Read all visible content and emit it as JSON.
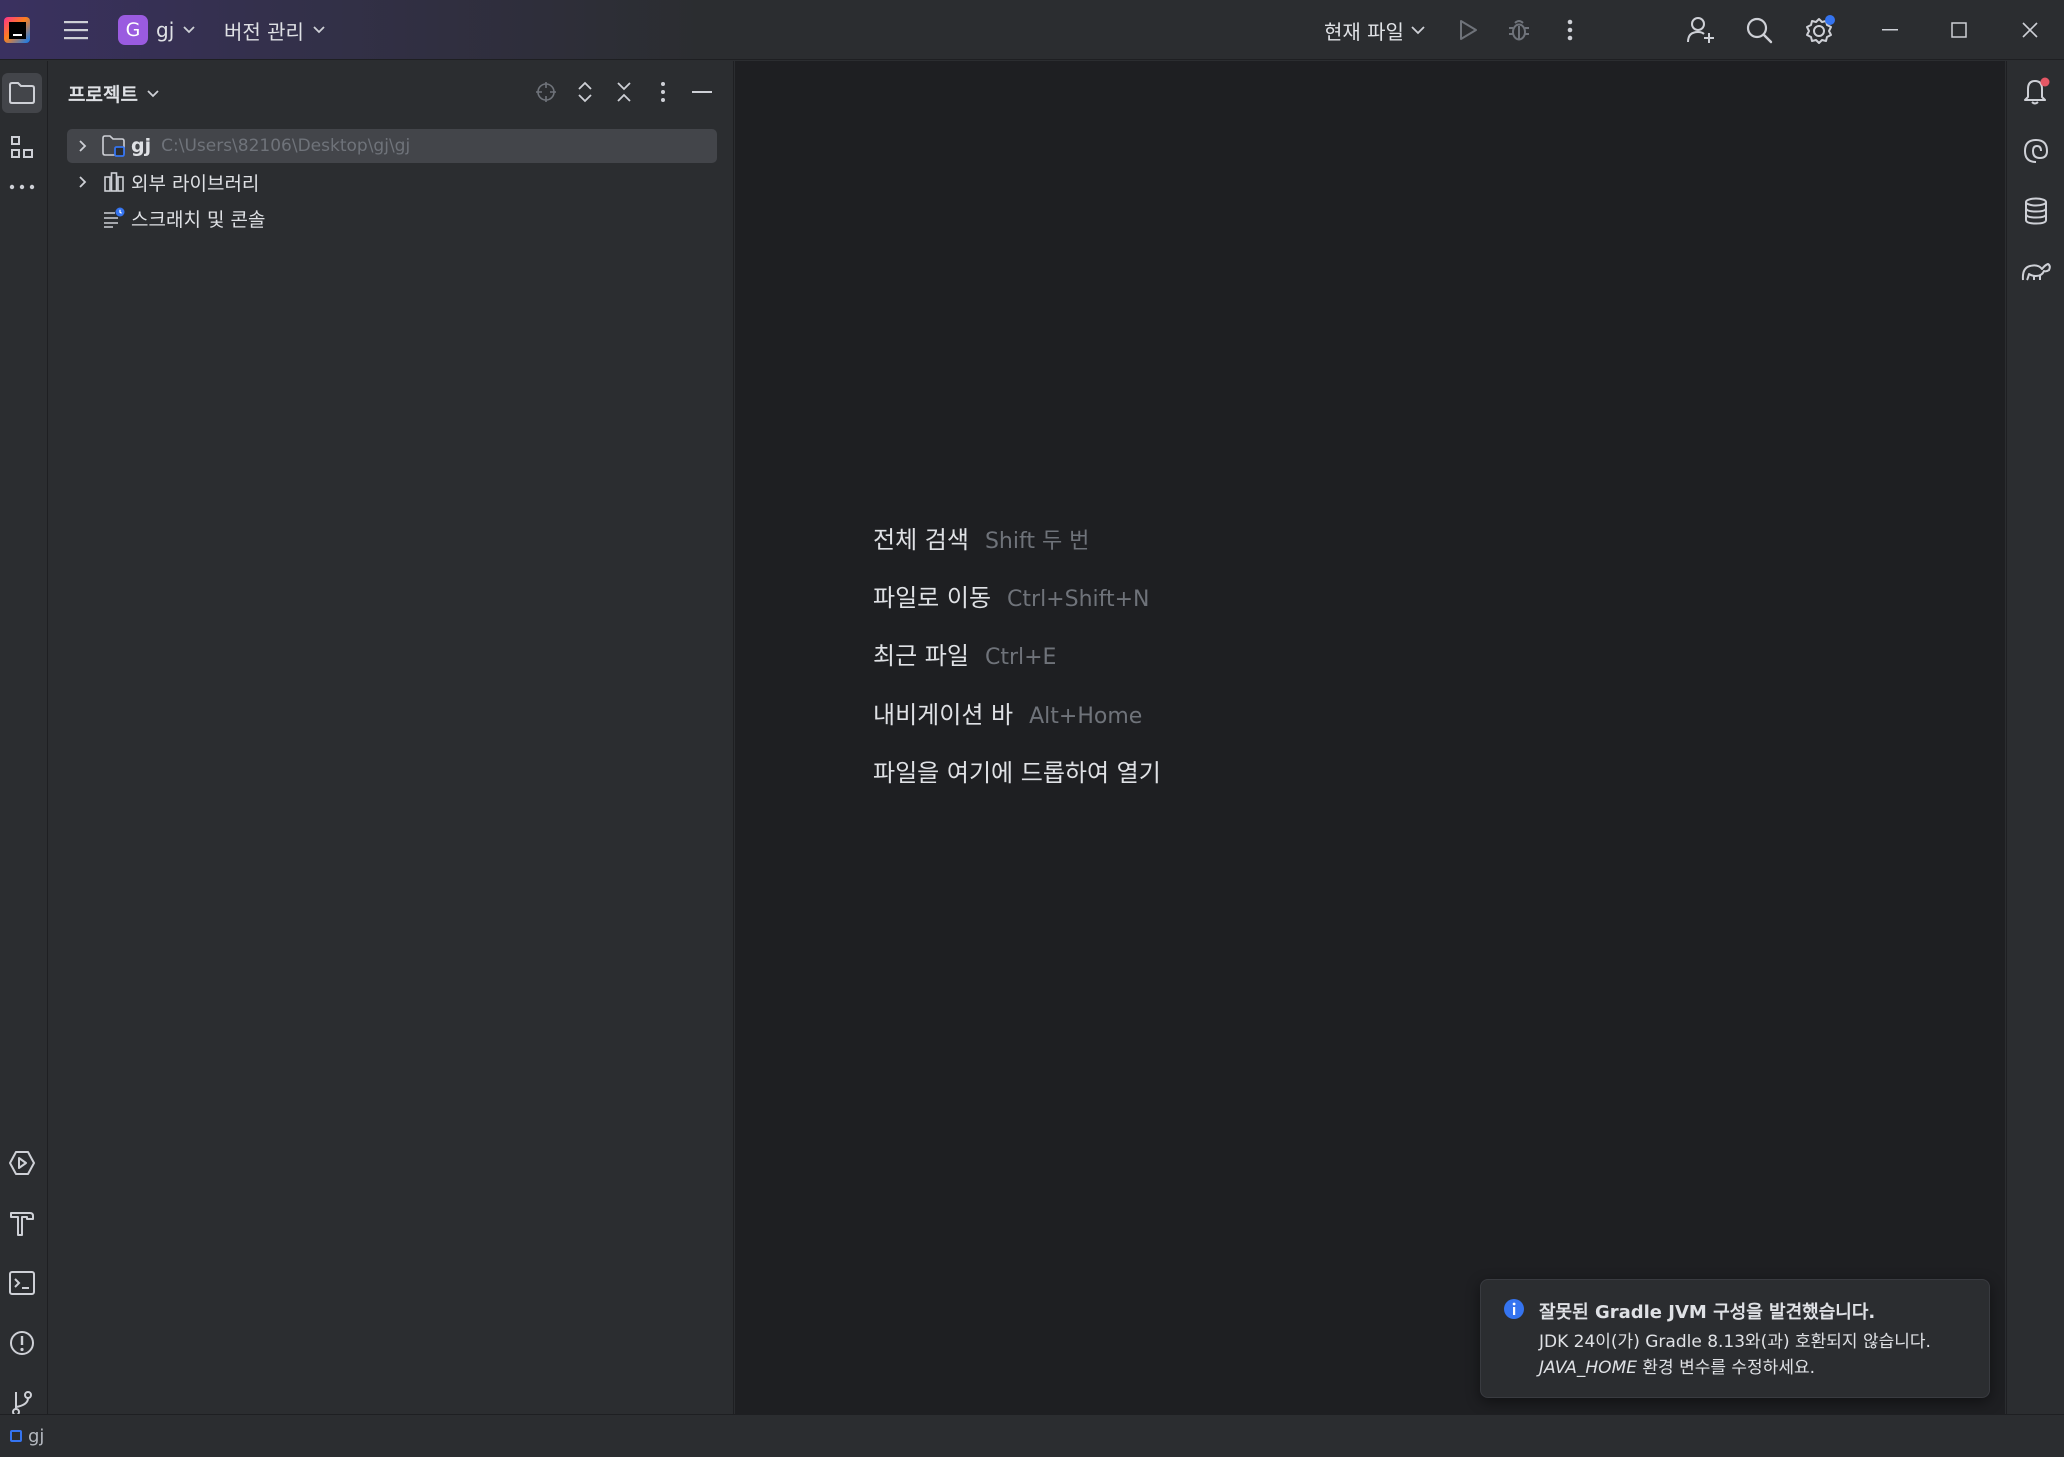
{
  "titlebar": {
    "project_badge": "G",
    "project_name": "gj",
    "vcs_label": "버전 관리",
    "run_config": "현재 파일"
  },
  "project_panel": {
    "title": "프로젝트",
    "tree": [
      {
        "name": "gj",
        "path": "C:\\Users\\82106\\Desktop\\gj\\gj",
        "icon": "module-folder-icon",
        "expandable": true,
        "selected": true
      },
      {
        "name": "외부 라이브러리",
        "path": "",
        "icon": "library-icon",
        "expandable": true,
        "selected": false
      },
      {
        "name": "스크래치 및 콘솔",
        "path": "",
        "icon": "scratches-icon",
        "expandable": false,
        "selected": false
      }
    ]
  },
  "editor_hints": [
    {
      "action": "전체 검색",
      "shortcut": "Shift 두 번"
    },
    {
      "action": "파일로 이동",
      "shortcut": "Ctrl+Shift+N"
    },
    {
      "action": "최근 파일",
      "shortcut": "Ctrl+E"
    },
    {
      "action": "내비게이션 바",
      "shortcut": "Alt+Home"
    },
    {
      "action": "파일을 여기에 드롭하여 열기",
      "shortcut": ""
    }
  ],
  "notification": {
    "title": "잘못된 Gradle JVM 구성을 발견했습니다.",
    "body_part1": "JDK 24이(가) Gradle 8.13와(과) 호환되지 않습니다. ",
    "body_em": "JAVA_HOME",
    "body_part2": " 환경 변수를 수정하세요."
  },
  "statusbar": {
    "breadcrumb": "gj"
  },
  "colors": {
    "accent": "#3574f0",
    "badge": "#9a5be0",
    "notification_dot": "#e55765"
  }
}
